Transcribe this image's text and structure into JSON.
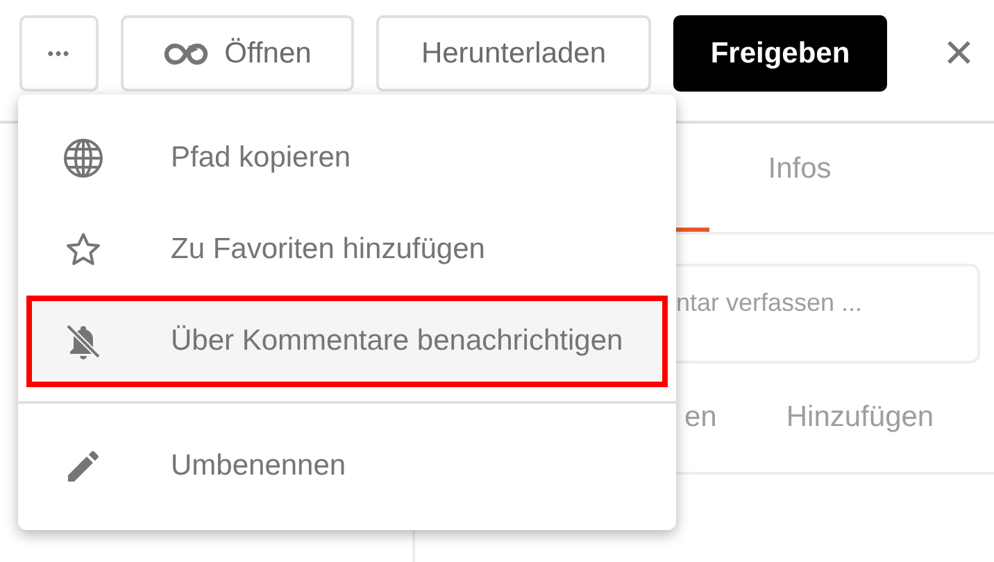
{
  "toolbar": {
    "buttons": [
      {
        "kind": "more",
        "label": "•••"
      },
      {
        "kind": "open",
        "label": "Öffnen"
      },
      {
        "kind": "plain",
        "label": "Herunterladen"
      },
      {
        "kind": "primary",
        "label": "Freigeben"
      },
      {
        "kind": "close",
        "label": "✕"
      }
    ]
  },
  "details": {
    "tabs": [
      {
        "selected": true
      },
      {
        "label": "Infos",
        "selected": false
      }
    ],
    "comment_field": {
      "placeholder": "ntar verfassen ..."
    },
    "actions": [
      "en",
      "Hinzufügen"
    ]
  },
  "menu": {
    "items": [
      {
        "kind": "globe",
        "label": "Pfad kopieren",
        "highlighted": false
      },
      {
        "kind": "star",
        "label": "Zu Favoriten hinzufügen",
        "highlighted": false
      },
      {
        "kind": "bell-off",
        "label": "Über Kommentare benachrichtigen",
        "highlighted": true
      },
      {
        "kind": "divider"
      },
      {
        "kind": "pencil",
        "label": "Umbenennen",
        "highlighted": false
      }
    ]
  }
}
